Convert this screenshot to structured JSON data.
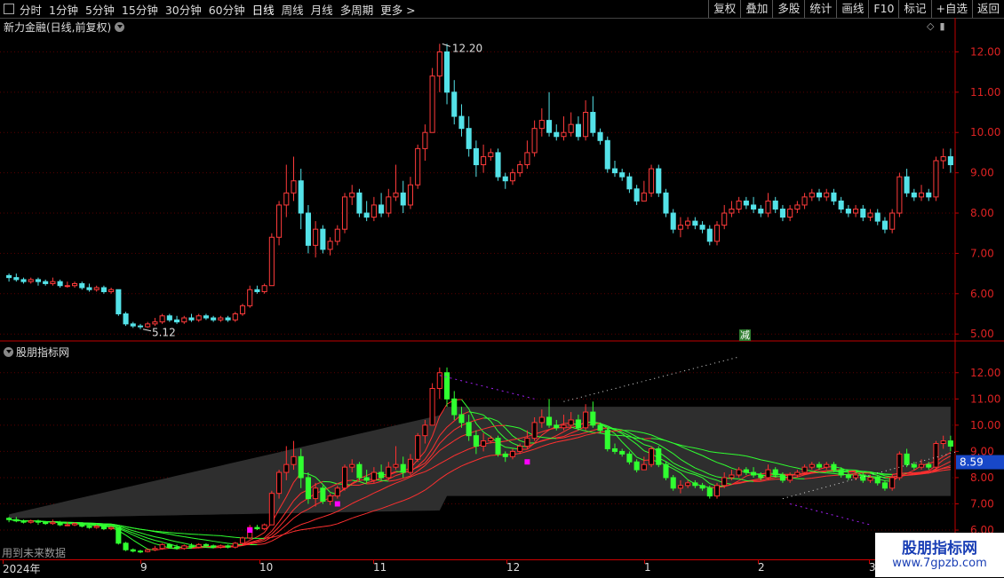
{
  "toolbar": {
    "periods": [
      "分时",
      "1分钟",
      "5分钟",
      "15分钟",
      "30分钟",
      "60分钟",
      "日线",
      "周线",
      "月线",
      "多周期",
      "更多 >"
    ],
    "active": "日线",
    "buttons": [
      "复权",
      "叠加",
      "多股",
      "统计",
      "画线",
      "F10",
      "标记",
      "+自选",
      "返回"
    ]
  },
  "main_title": "新力金融(日线,前复权)",
  "indicator_title": "股朋指标网",
  "future_label": "用到未来数据",
  "reduce_label": "减",
  "price_axis": [
    "12.00",
    "11.00",
    "10.00",
    "9.00",
    "8.00",
    "7.00",
    "6.00",
    "5.00"
  ],
  "ind_axis": [
    "12.00",
    "11.00",
    "10.00",
    "9.00",
    "8.00",
    "7.00",
    "6.00"
  ],
  "current_value": "8.59",
  "high_marker": "12.20",
  "low_marker": "5.12",
  "x_labels": [
    "2024年",
    "9",
    "10",
    "11",
    "12",
    "1",
    "2",
    "3"
  ],
  "watermark": {
    "line1": "股朋指标网",
    "line2": "www.7gpzb.com"
  },
  "colors": {
    "up": "#ff3b3b",
    "down": "#54e2e8",
    "axis": "#c00000",
    "ind_up": "#ff3030",
    "ind_down": "#30ff30"
  },
  "chart_data": {
    "type": "candlestick",
    "ylim": [
      4.85,
      12.45
    ],
    "candles": [
      [
        6.45,
        6.4,
        6.5,
        6.3
      ],
      [
        6.4,
        6.35,
        6.5,
        6.3
      ],
      [
        6.35,
        6.3,
        6.4,
        6.25
      ],
      [
        6.3,
        6.35,
        6.4,
        6.25
      ],
      [
        6.35,
        6.3,
        6.4,
        6.2
      ],
      [
        6.3,
        6.25,
        6.35,
        6.2
      ],
      [
        6.25,
        6.3,
        6.4,
        6.2
      ],
      [
        6.3,
        6.2,
        6.35,
        6.15
      ],
      [
        6.2,
        6.2,
        6.3,
        6.15
      ],
      [
        6.2,
        6.25,
        6.3,
        6.15
      ],
      [
        6.25,
        6.15,
        6.3,
        6.1
      ],
      [
        6.15,
        6.1,
        6.25,
        6.05
      ],
      [
        6.1,
        6.15,
        6.2,
        6.05
      ],
      [
        6.15,
        6.05,
        6.2,
        6.0
      ],
      [
        6.05,
        6.1,
        6.15,
        6.0
      ],
      [
        6.1,
        5.5,
        6.1,
        5.45
      ],
      [
        5.5,
        5.25,
        5.55,
        5.2
      ],
      [
        5.25,
        5.2,
        5.3,
        5.15
      ],
      [
        5.2,
        5.18,
        5.25,
        5.12
      ],
      [
        5.18,
        5.25,
        5.3,
        5.15
      ],
      [
        5.25,
        5.3,
        5.4,
        5.2
      ],
      [
        5.3,
        5.45,
        5.5,
        5.25
      ],
      [
        5.45,
        5.35,
        5.5,
        5.3
      ],
      [
        5.35,
        5.3,
        5.45,
        5.25
      ],
      [
        5.3,
        5.4,
        5.45,
        5.25
      ],
      [
        5.4,
        5.35,
        5.5,
        5.3
      ],
      [
        5.35,
        5.45,
        5.5,
        5.3
      ],
      [
        5.45,
        5.4,
        5.5,
        5.35
      ],
      [
        5.4,
        5.35,
        5.45,
        5.3
      ],
      [
        5.35,
        5.4,
        5.45,
        5.3
      ],
      [
        5.4,
        5.35,
        5.45,
        5.3
      ],
      [
        5.35,
        5.5,
        5.55,
        5.3
      ],
      [
        5.5,
        5.7,
        5.75,
        5.45
      ],
      [
        5.7,
        6.1,
        6.2,
        5.65
      ],
      [
        6.1,
        6.05,
        6.2,
        6.0
      ],
      [
        6.05,
        6.2,
        6.25,
        6.0
      ],
      [
        6.2,
        7.4,
        7.5,
        7.1
      ],
      [
        7.4,
        8.2,
        8.3,
        7.2
      ],
      [
        8.2,
        8.5,
        9.2,
        7.9
      ],
      [
        8.5,
        8.8,
        9.4,
        8.3
      ],
      [
        8.8,
        8.0,
        9.1,
        7.6
      ],
      [
        8.0,
        7.2,
        8.2,
        7.0
      ],
      [
        7.2,
        7.6,
        7.8,
        6.9
      ],
      [
        7.6,
        7.1,
        7.7,
        7.0
      ],
      [
        7.1,
        7.3,
        7.4,
        6.95
      ],
      [
        7.3,
        7.6,
        7.7,
        7.2
      ],
      [
        7.6,
        8.4,
        8.5,
        7.5
      ],
      [
        8.4,
        8.5,
        8.7,
        8.2
      ],
      [
        8.5,
        8.0,
        8.6,
        7.9
      ],
      [
        8.0,
        7.9,
        8.3,
        7.8
      ],
      [
        7.9,
        8.2,
        8.4,
        7.8
      ],
      [
        8.2,
        8.0,
        8.5,
        7.9
      ],
      [
        8.0,
        8.4,
        8.6,
        7.9
      ],
      [
        8.4,
        8.5,
        9.2,
        8.3
      ],
      [
        8.5,
        8.2,
        8.8,
        8.0
      ],
      [
        8.2,
        8.7,
        8.9,
        8.1
      ],
      [
        8.7,
        9.6,
        9.7,
        8.6
      ],
      [
        9.6,
        10.0,
        10.2,
        9.3
      ],
      [
        10.0,
        11.4,
        11.6,
        10.0
      ],
      [
        11.4,
        12.0,
        12.2,
        11.0
      ],
      [
        12.0,
        11.0,
        12.2,
        10.7
      ],
      [
        11.0,
        10.4,
        11.3,
        10.2
      ],
      [
        10.4,
        10.1,
        10.7,
        9.9
      ],
      [
        10.1,
        9.6,
        10.4,
        9.4
      ],
      [
        9.6,
        9.2,
        9.8,
        8.9
      ],
      [
        9.2,
        9.4,
        9.7,
        9.0
      ],
      [
        9.4,
        9.5,
        9.6,
        9.3
      ],
      [
        9.5,
        8.9,
        9.6,
        8.8
      ],
      [
        8.9,
        8.8,
        9.0,
        8.6
      ],
      [
        8.8,
        9.0,
        9.1,
        8.7
      ],
      [
        9.0,
        9.2,
        9.3,
        8.9
      ],
      [
        9.2,
        9.5,
        9.8,
        9.1
      ],
      [
        9.5,
        10.1,
        10.3,
        9.4
      ],
      [
        10.1,
        10.3,
        10.6,
        9.9
      ],
      [
        10.3,
        10.0,
        11.0,
        9.9
      ],
      [
        10.0,
        9.9,
        10.2,
        9.8
      ],
      [
        9.9,
        10.0,
        10.4,
        9.8
      ],
      [
        10.0,
        10.2,
        10.5,
        9.9
      ],
      [
        10.2,
        9.9,
        10.4,
        9.8
      ],
      [
        9.9,
        10.5,
        10.8,
        9.8
      ],
      [
        10.5,
        10.0,
        10.9,
        9.9
      ],
      [
        10.0,
        9.8,
        10.1,
        9.7
      ],
      [
        9.8,
        9.1,
        9.9,
        9.0
      ],
      [
        9.1,
        9.0,
        9.3,
        8.9
      ],
      [
        9.0,
        8.9,
        9.1,
        8.8
      ],
      [
        8.9,
        8.6,
        9.0,
        8.5
      ],
      [
        8.6,
        8.3,
        8.7,
        8.2
      ],
      [
        8.3,
        8.5,
        8.8,
        8.3
      ],
      [
        8.5,
        9.1,
        9.2,
        8.4
      ],
      [
        9.1,
        8.5,
        9.2,
        8.4
      ],
      [
        8.5,
        8.0,
        8.6,
        7.9
      ],
      [
        8.0,
        7.6,
        8.1,
        7.5
      ],
      [
        7.6,
        7.7,
        7.9,
        7.4
      ],
      [
        7.7,
        7.8,
        7.9,
        7.6
      ],
      [
        7.8,
        7.7,
        7.9,
        7.6
      ],
      [
        7.7,
        7.6,
        7.8,
        7.5
      ],
      [
        7.6,
        7.3,
        7.7,
        7.2
      ],
      [
        7.3,
        7.7,
        7.8,
        7.2
      ],
      [
        7.7,
        8.0,
        8.2,
        7.6
      ],
      [
        8.0,
        8.1,
        8.3,
        7.9
      ],
      [
        8.1,
        8.3,
        8.4,
        8.0
      ],
      [
        8.3,
        8.2,
        8.4,
        8.1
      ],
      [
        8.2,
        8.1,
        8.4,
        8.0
      ],
      [
        8.1,
        8.0,
        8.2,
        7.9
      ],
      [
        8.0,
        8.3,
        8.5,
        7.9
      ],
      [
        8.3,
        8.1,
        8.4,
        8.0
      ],
      [
        8.1,
        7.9,
        8.2,
        7.8
      ],
      [
        7.9,
        8.1,
        8.2,
        7.8
      ],
      [
        8.1,
        8.2,
        8.3,
        8.0
      ],
      [
        8.2,
        8.4,
        8.5,
        8.1
      ],
      [
        8.4,
        8.5,
        8.6,
        8.3
      ],
      [
        8.5,
        8.4,
        8.6,
        8.3
      ],
      [
        8.4,
        8.5,
        8.6,
        8.3
      ],
      [
        8.5,
        8.3,
        8.6,
        8.2
      ],
      [
        8.3,
        8.1,
        8.4,
        8.0
      ],
      [
        8.1,
        8.0,
        8.2,
        7.9
      ],
      [
        8.0,
        8.1,
        8.2,
        7.9
      ],
      [
        8.1,
        7.9,
        8.2,
        7.8
      ],
      [
        7.9,
        8.0,
        8.1,
        7.8
      ],
      [
        8.0,
        7.8,
        8.1,
        7.7
      ],
      [
        7.8,
        7.6,
        7.9,
        7.5
      ],
      [
        7.6,
        8.0,
        8.1,
        7.5
      ],
      [
        8.0,
        8.9,
        9.0,
        7.9
      ],
      [
        8.9,
        8.5,
        9.1,
        8.4
      ],
      [
        8.5,
        8.4,
        8.6,
        8.3
      ],
      [
        8.4,
        8.5,
        8.7,
        8.3
      ],
      [
        8.5,
        8.4,
        8.6,
        8.3
      ],
      [
        8.4,
        9.3,
        9.4,
        8.3
      ],
      [
        9.3,
        9.4,
        9.6,
        9.1
      ],
      [
        9.4,
        9.2,
        9.6,
        9.0
      ]
    ]
  }
}
